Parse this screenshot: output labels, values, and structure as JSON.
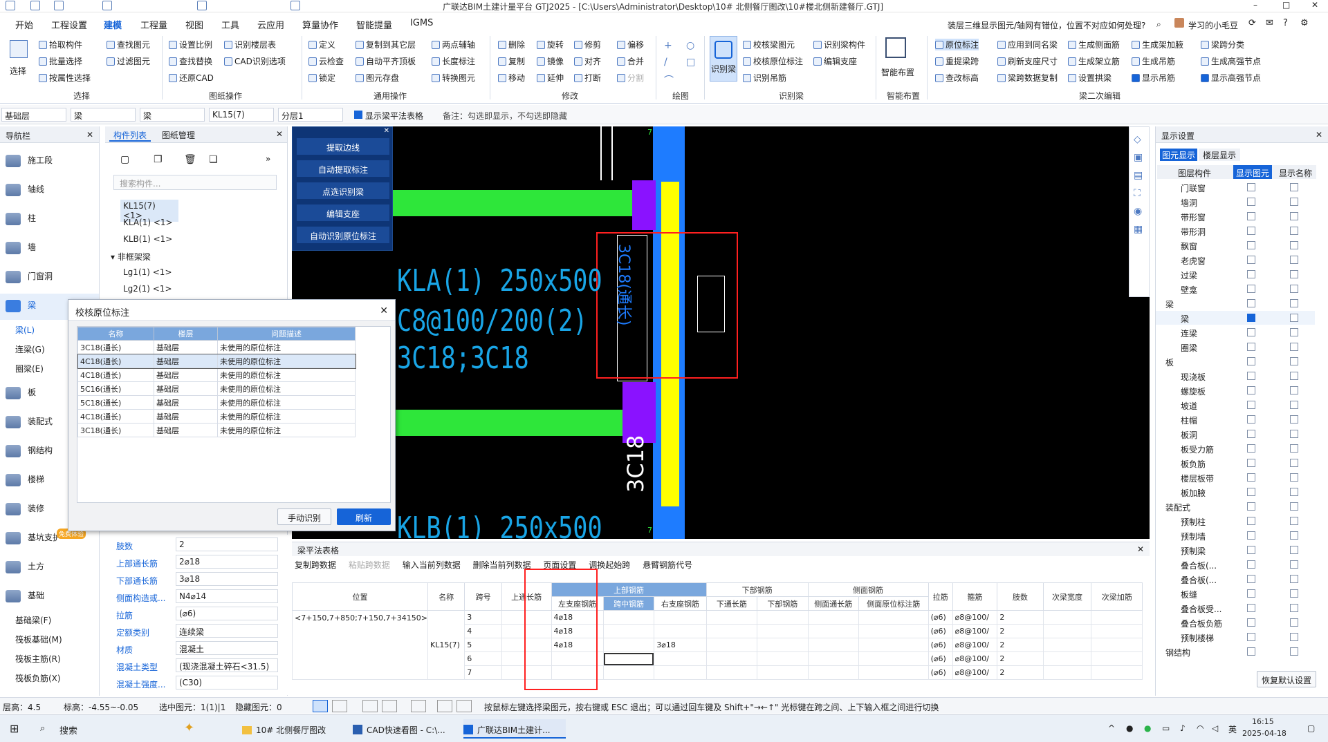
{
  "title_bar": {
    "text": "广联达BIM土建计量平台 GTJ2025 - [C:\\Users\\Administrator\\Desktop\\10# 北侧餐厅图改\\10#楼北侧新建餐厅.GTJ]",
    "win_min": "–",
    "win_max": "□",
    "win_close": "✕"
  },
  "menu": [
    "开始",
    "工程设置",
    "建模",
    "工程量",
    "视图",
    "工具",
    "云应用",
    "算量协作",
    "智能提量",
    "IGMS"
  ],
  "menu_active": "建模",
  "help_search": {
    "question": "装层三维显示图元/轴网有错位，位置不对应如何处理?",
    "user": "学习的小毛豆"
  },
  "ribbon": {
    "select": {
      "big": "选择",
      "items": [
        "拾取构件",
        "批量选择",
        "按属性选择",
        "查找图元",
        "过滤图元"
      ],
      "label": "选择"
    },
    "drawing": {
      "items": [
        "设置比例",
        "识别楼层表",
        "查找替换",
        "CAD识别选项",
        "还原CAD"
      ],
      "label": "图纸操作"
    },
    "general": {
      "items": [
        "定义",
        "复制到其它层",
        "两点辅轴",
        "云检查",
        "自动平齐顶板",
        "长度标注",
        "锁定",
        "图元存盘",
        "转换图元"
      ],
      "label": "通用操作"
    },
    "modify": {
      "items": [
        "删除",
        "旋转",
        "修剪",
        "偏移",
        "复制",
        "镜像",
        "对齐",
        "合并",
        "移动",
        "延伸",
        "打断",
        "分割"
      ],
      "label": "修改"
    },
    "draw": {
      "label": "绘图"
    },
    "recognize": {
      "big": "识别梁",
      "items": [
        "校核梁图元",
        "识别梁构件",
        "校核原位标注",
        "编辑支座",
        "识别吊筋"
      ],
      "label": "识别梁"
    },
    "smart": {
      "big": "智能布置",
      "label": "智能布置"
    },
    "beam2": {
      "items": [
        "原位标注",
        "应用到同名梁",
        "生成侧面筋",
        "生成架加腋",
        "梁跨分类",
        "重提梁跨",
        "刷新支座尺寸",
        "生成架立筋",
        "生成吊筋",
        "生成高强节点",
        "查改标高",
        "梁跨数据复制",
        "设置拱梁",
        "显示吊筋",
        "显示高强节点"
      ],
      "label": "梁二次编辑"
    }
  },
  "filter_bar": {
    "floor": "基础层",
    "type1": "梁",
    "type2": "梁",
    "comp": "KL15(7)",
    "layer": "分层1",
    "check_label": "显示梁平法表格",
    "note": "备注：勾选即显示，不勾选即隐藏"
  },
  "nav": {
    "title": "导航栏",
    "items": [
      "施工段",
      "轴线",
      "柱",
      "墙",
      "门窗洞",
      "梁",
      "板",
      "装配式",
      "钢结构",
      "楼梯",
      "装修",
      "基坑支护",
      "土方",
      "基础"
    ],
    "sub_beam": [
      "梁(L)",
      "连梁(G)",
      "圈梁(E)"
    ],
    "sub_found": [
      "基础梁(F)",
      "筏板基础(M)",
      "筏板主筋(R)",
      "筏板负筋(X)"
    ],
    "badge": "免费体验"
  },
  "comp_list": {
    "tab1": "构件列表",
    "tab2": "图纸管理",
    "search": "搜索构件...",
    "items": [
      "KL15(7) <1>",
      "KLA(1) <1>",
      "KLB(1) <1>"
    ],
    "group": "非框架梁",
    "items2": [
      "Lg1(1) <1>",
      "Lg2(1) <1>"
    ]
  },
  "float_tools": [
    "提取边线",
    "自动提取标注",
    "点选识别梁",
    "编辑支座",
    "自动识别原位标注"
  ],
  "cad_text": {
    "t1": "KLA(1) 250x500",
    "t2": "C8@100/200(2)",
    "t3": "3C18;3C18",
    "t4": "3C18(通长)",
    "t5": "3C18",
    "t6": "KLB(1) 250x500",
    "axis": "7"
  },
  "dialog": {
    "title": "校核原位标注",
    "headers": [
      "名称",
      "楼层",
      "问题描述"
    ],
    "rows": [
      [
        "3C18(通长)",
        "基础层",
        "未使用的原位标注"
      ],
      [
        "4C18(通长)",
        "基础层",
        "未使用的原位标注"
      ],
      [
        "4C18(通长)",
        "基础层",
        "未使用的原位标注"
      ],
      [
        "5C16(通长)",
        "基础层",
        "未使用的原位标注"
      ],
      [
        "5C18(通长)",
        "基础层",
        "未使用的原位标注"
      ],
      [
        "4C18(通长)",
        "基础层",
        "未使用的原位标注"
      ],
      [
        "3C18(通长)",
        "基础层",
        "未使用的原位标注"
      ]
    ],
    "btn_manual": "手动识别",
    "btn_refresh": "刷新"
  },
  "props": [
    [
      "肢数",
      "2"
    ],
    [
      "上部通长筋",
      "2⌀18"
    ],
    [
      "下部通长筋",
      "3⌀18"
    ],
    [
      "侧面构造或...",
      "N4⌀14"
    ],
    [
      "拉筋",
      "(⌀6)"
    ],
    [
      "定额类别",
      "连续梁"
    ],
    [
      "材质",
      "混凝土"
    ],
    [
      "混凝土类型",
      "(现浇混凝土碎石<31.5)"
    ],
    [
      "混凝土强度...",
      "(C30)"
    ]
  ],
  "beam_table": {
    "title": "梁平法表格",
    "tools": [
      "复制跨数据",
      "粘贴跨数据",
      "输入当前列数据",
      "删除当前列数据",
      "页面设置",
      "调换起始跨",
      "悬臂钢筋代号"
    ],
    "headers": [
      "位置",
      "名称",
      "跨号",
      "上通长筋",
      "左支座钢筋",
      "跨中钢筋",
      "右支座钢筋",
      "下通长筋",
      "下部钢筋",
      "侧面通长筋",
      "侧面原位标注筋",
      "拉筋",
      "箍筋",
      "肢数",
      "次梁宽度",
      "次梁加筋"
    ],
    "group_top": "上部钢筋",
    "group_bottom": "下部钢筋",
    "group_side": "侧面钢筋",
    "position": "<7+150,7+850;7+150,7+34150>",
    "name": "KL15(7)",
    "rows": [
      [
        "3",
        "4⌀18",
        "",
        ""
      ],
      [
        "4",
        "4⌀18",
        "",
        ""
      ],
      [
        "5",
        "4⌀18",
        "",
        "3⌀18"
      ],
      [
        "6",
        "",
        "",
        ""
      ],
      [
        "7",
        "",
        "",
        ""
      ]
    ],
    "stirrup": "⌀8@100/",
    "tie": "(⌀6)",
    "legs": "2"
  },
  "display_settings": {
    "title": "显示设置",
    "tab1": "图元显示",
    "tab2": "楼层显示",
    "col1": "图层构件",
    "col2": "显示图元",
    "col3": "显示名称",
    "rows": [
      "门联窗",
      "墙洞",
      "带形窗",
      "带形洞",
      "飘窗",
      "老虎窗",
      "过梁",
      "壁龛",
      "梁",
      "梁",
      "连梁",
      "圈梁",
      "板",
      "现浇板",
      "螺旋板",
      "坡道",
      "柱帽",
      "板洞",
      "板受力筋",
      "板负筋",
      "楼层板带",
      "板加腋",
      "装配式",
      "预制柱",
      "预制墙",
      "预制梁",
      "叠合板(...",
      "叠合板(...",
      "板缝",
      "叠合板受...",
      "叠合板负筋",
      "预制楼梯",
      "钢结构"
    ],
    "reset": "恢复默认设置"
  },
  "status_bar": {
    "floor_h": "层高：4.5",
    "elev": "标高：-4.55~-0.05",
    "selected": "选中图元：1(1)|1",
    "hidden": "隐藏图元：0",
    "hint": "按鼠标左键选择梁图元，按右键或 ESC 退出；可以通过回车键及 Shift+\"→←↑\" 光标键在跨之间、上下输入框之间进行切换"
  },
  "taskbar": {
    "search": "搜索",
    "apps": [
      "10# 北侧餐厅图改",
      "CAD快速看图 - C:\\...",
      "广联达BIM土建计..."
    ],
    "ime": "英",
    "time": "16:15",
    "date": "2025-04-18"
  },
  "colors": {
    "accent": "#1664d8",
    "cad_bg": "#000000",
    "beam_green": "#2ee63a",
    "column_yellow": "#ffff00",
    "support_purple": "#8a12ff",
    "blue_bar": "#1e7cff",
    "red_box": "#ff2020"
  }
}
